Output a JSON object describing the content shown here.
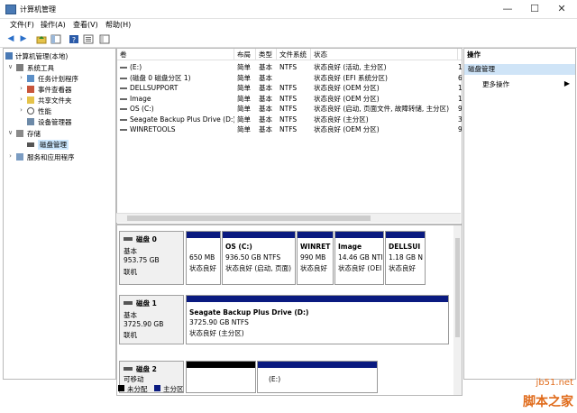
{
  "window": {
    "title": "计算机管理"
  },
  "menu": [
    "文件(F)",
    "操作(A)",
    "查看(V)",
    "帮助(H)"
  ],
  "tree": {
    "root": "计算机管理(本地)",
    "system_tools": "系统工具",
    "task_scheduler": "任务计划程序",
    "event_viewer": "事件查看器",
    "shared_folders": "共享文件夹",
    "performance": "性能",
    "device_manager": "设备管理器",
    "storage": "存储",
    "disk_management": "磁盘管理",
    "services": "服务和应用程序"
  },
  "volumes": {
    "columns": [
      "卷",
      "布局",
      "类型",
      "文件系统",
      "状态"
    ],
    "rows": [
      {
        "vol": "(E:)",
        "layout": "简单",
        "type": "基本",
        "fs": "NTFS",
        "status": "状态良好 (活动, 主分区)"
      },
      {
        "vol": "(磁盘 0 磁盘分区 1)",
        "layout": "简单",
        "type": "基本",
        "fs": "",
        "status": "状态良好 (EFI 系统分区)"
      },
      {
        "vol": "DELLSUPPORT",
        "layout": "简单",
        "type": "基本",
        "fs": "NTFS",
        "status": "状态良好 (OEM 分区)"
      },
      {
        "vol": "Image",
        "layout": "简单",
        "type": "基本",
        "fs": "NTFS",
        "status": "状态良好 (OEM 分区)"
      },
      {
        "vol": "OS (C:)",
        "layout": "简单",
        "type": "基本",
        "fs": "NTFS",
        "status": "状态良好 (启动, 页面文件, 故障转储, 主分区)"
      },
      {
        "vol": "Seagate Backup Plus Drive (D:)",
        "layout": "简单",
        "type": "基本",
        "fs": "NTFS",
        "status": "状态良好 (主分区)"
      },
      {
        "vol": "WINRETOOLS",
        "layout": "简单",
        "type": "基本",
        "fs": "NTFS",
        "status": "状态良好 (OEM 分区)"
      }
    ],
    "right_edge_chars": [
      "1",
      "6",
      "1",
      "1",
      "9",
      "3",
      "9"
    ]
  },
  "disks": [
    {
      "name": "磁盘 0",
      "kind": "基本",
      "size": "953.75 GB",
      "state": "联机",
      "partitions": [
        {
          "label": "",
          "size": "650 MB",
          "status": "状态良好"
        },
        {
          "label": "OS  (C:)",
          "size": "936.50 GB NTFS",
          "status": "状态良好 (启动, 页面)"
        },
        {
          "label": "WINRET",
          "size": "990 MB",
          "status": "状态良好"
        },
        {
          "label": "Image",
          "size": "14.46 GB NTI",
          "status": "状态良好 (OEI"
        },
        {
          "label": "DELLSUI",
          "size": "1.18 GB N",
          "status": "状态良好"
        }
      ]
    },
    {
      "name": "磁盘 1",
      "kind": "基本",
      "size": "3725.90 GB",
      "state": "联机",
      "partitions": [
        {
          "label": "Seagate Backup Plus Drive  (D:)",
          "size": "3725.90 GB NTFS",
          "status": "状态良好 (主分区)"
        }
      ]
    },
    {
      "name": "磁盘 2",
      "kind": "可移动",
      "size": "",
      "state": "",
      "partitions": [
        {
          "label": "",
          "size": "",
          "status": ""
        },
        {
          "label": "(E:)",
          "size": "",
          "status": ""
        }
      ]
    }
  ],
  "legend": {
    "unallocated": "未分配",
    "primary": "主分区",
    "unallocated_color": "#000000",
    "primary_color": "#0a1a80"
  },
  "actions": {
    "header": "操作",
    "section": "磁盘管理",
    "more": "更多操作"
  },
  "watermark": {
    "line1": "jb51.net",
    "line2": "脚本之家"
  }
}
